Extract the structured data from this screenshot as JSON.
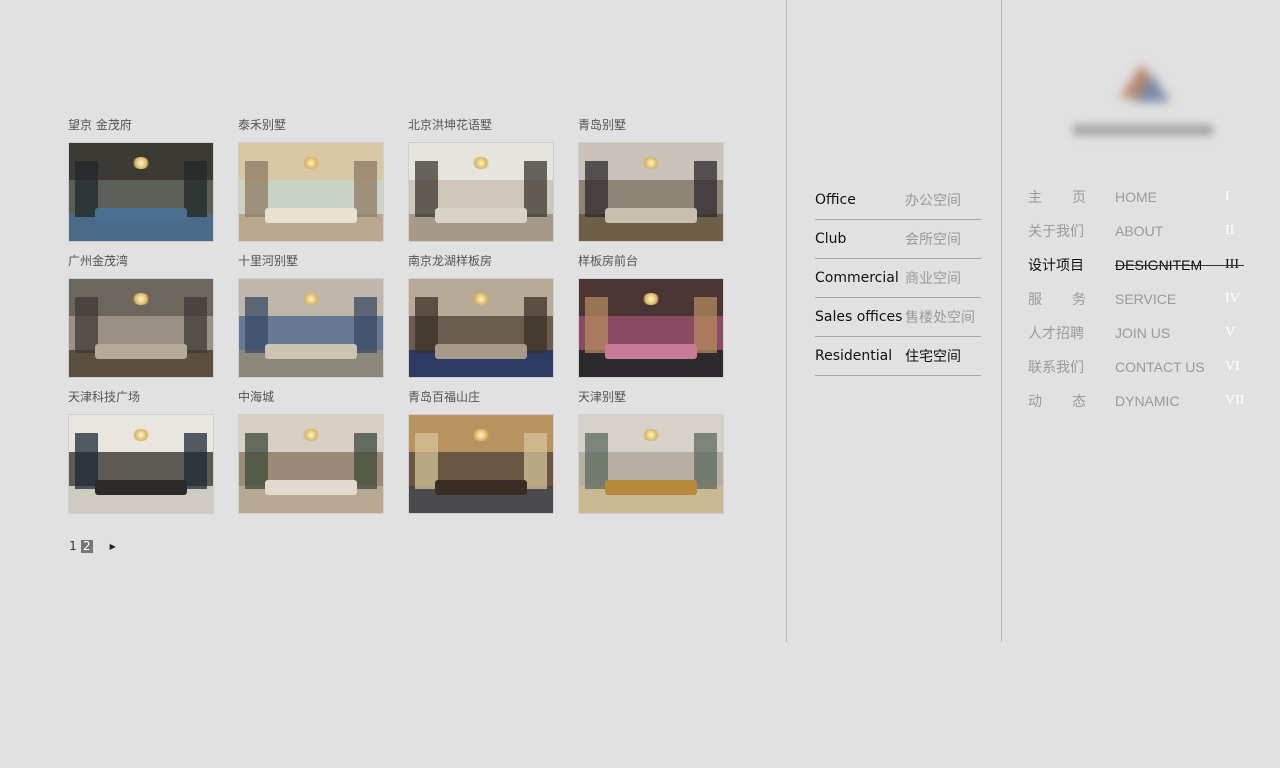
{
  "gallery": {
    "items": [
      {
        "title": "望京  金茂府",
        "colors": {
          "ceil": "#3b3a34",
          "wall": "#5a5f57",
          "floor": "#4a6b88",
          "sofa": "#4c6f90",
          "panel": "#23272a"
        }
      },
      {
        "title": "泰禾别墅",
        "colors": {
          "ceil": "#d8c6a4",
          "wall": "#c9d4c4",
          "floor": "#b9a790",
          "sofa": "#e8e1d1",
          "panel": "#8f7a63"
        }
      },
      {
        "title": "北京洪坤花语墅",
        "colors": {
          "ceil": "#e6e4df",
          "wall": "#cdc6b9",
          "floor": "#a59a88",
          "sofa": "#d9d3c7",
          "panel": "#3b3833"
        }
      },
      {
        "title": "青岛别墅",
        "colors": {
          "ceil": "#c9c3b9",
          "wall": "#8f8577",
          "floor": "#6e5f47",
          "sofa": "#c9bfae",
          "panel": "#2d2a2d"
        }
      },
      {
        "title": "广州金茂湾",
        "colors": {
          "ceil": "#6d665c",
          "wall": "#9b9184",
          "floor": "#5a4e3f",
          "sofa": "#b5aa96",
          "panel": "#3e3a35"
        }
      },
      {
        "title": "十里河别墅",
        "colors": {
          "ceil": "#bfb8aa",
          "wall": "#667a95",
          "floor": "#8b8779",
          "sofa": "#cbc4b0",
          "panel": "#3b4a63"
        }
      },
      {
        "title": "南京龙湖样板房",
        "colors": {
          "ceil": "#b7ab97",
          "wall": "#6a5d4d",
          "floor": "#2e3a64",
          "sofa": "#a9998a",
          "panel": "#3b3026"
        }
      },
      {
        "title": "样板房前台",
        "colors": {
          "ceil": "#4a3434",
          "wall": "#8a4a63",
          "floor": "#2c2a2c",
          "sofa": "#c77b98",
          "panel": "#b48a5e"
        }
      },
      {
        "title": "天津科技广场",
        "colors": {
          "ceil": "#e9e6e0",
          "wall": "#5d5a56",
          "floor": "#cfcac2",
          "sofa": "#2c2a28",
          "panel": "#1d2a35"
        }
      },
      {
        "title": "中海城",
        "colors": {
          "ceil": "#d8d0c3",
          "wall": "#9b8a77",
          "floor": "#b6a891",
          "sofa": "#e2dbcd",
          "panel": "#3f4a3a"
        }
      },
      {
        "title": "青岛百福山庄",
        "colors": {
          "ceil": "#b9935f",
          "wall": "#6a5542",
          "floor": "#4a4a4e",
          "sofa": "#3a2e24",
          "panel": "#d6c39a"
        }
      },
      {
        "title": "天津别墅",
        "colors": {
          "ceil": "#d7d2c9",
          "wall": "#b7b0a2",
          "floor": "#c9b892",
          "sofa": "#b78a3b",
          "panel": "#5c6b5d"
        }
      }
    ]
  },
  "pager": {
    "page1": "1",
    "page2": "2",
    "next": "▶",
    "current": 2
  },
  "categories": [
    {
      "en": "Office",
      "zh": "办公空间",
      "active": false
    },
    {
      "en": "Club",
      "zh": "会所空间",
      "active": false
    },
    {
      "en": "Commercial",
      "zh": "商业空间",
      "active": false
    },
    {
      "en": "Sales offices",
      "zh": "售楼处空间",
      "active": false
    },
    {
      "en": "Residential",
      "zh": "住宅空间",
      "active": true
    }
  ],
  "nav": [
    {
      "zh": [
        "主",
        "页"
      ],
      "en": "HOME",
      "num": "I",
      "active": false
    },
    {
      "zh": [
        "关于我们"
      ],
      "en": "ABOUT",
      "num": "II",
      "active": false
    },
    {
      "zh": [
        "设计项目"
      ],
      "en": "DESIGNITEM",
      "num": "III",
      "active": true
    },
    {
      "zh": [
        "服",
        "务"
      ],
      "en": "SERVICE",
      "num": "IV",
      "active": false
    },
    {
      "zh": [
        "人才招聘"
      ],
      "en": "JOIN US",
      "num": "V",
      "active": false
    },
    {
      "zh": [
        "联系我们"
      ],
      "en": "CONTACT US",
      "num": "VI",
      "active": false
    },
    {
      "zh": [
        "动",
        "态"
      ],
      "en": "DYNAMIC",
      "num": "VII",
      "active": false
    }
  ],
  "colors": {
    "background": "#e1e1e1",
    "divider": "#b9b9b9",
    "text_active": "#111111",
    "text_muted": "#9a9a9a",
    "numeral": "#ffffff"
  }
}
